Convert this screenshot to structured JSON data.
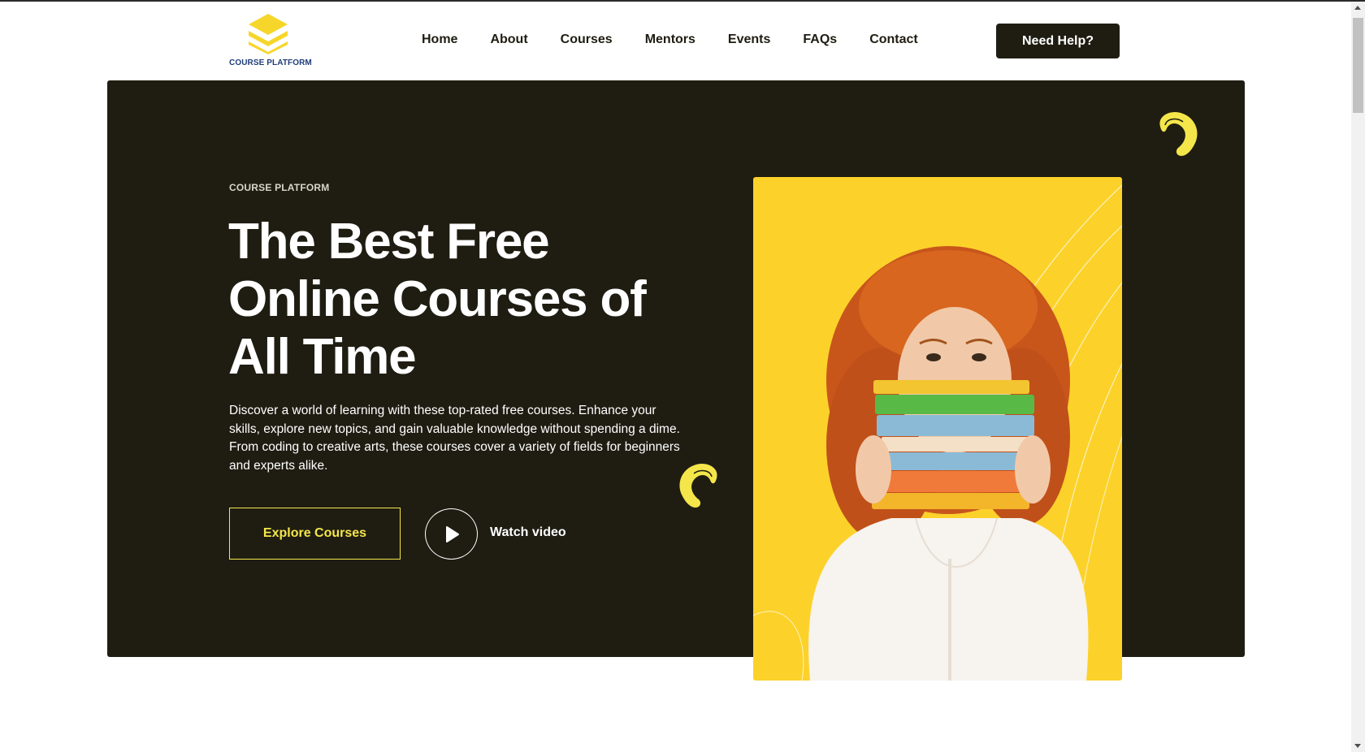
{
  "brand": {
    "name": "COURSE PLATFORM",
    "logo_icon": "stacked-layers-logo-icon"
  },
  "nav": {
    "items": [
      {
        "label": "Home"
      },
      {
        "label": "About"
      },
      {
        "label": "Courses"
      },
      {
        "label": "Mentors"
      },
      {
        "label": "Events"
      },
      {
        "label": "FAQs"
      },
      {
        "label": "Contact"
      }
    ],
    "cta_label": "Need Help?"
  },
  "hero": {
    "eyebrow": "COURSE PLATFORM",
    "headline": "The Best Free Online Courses of All Time",
    "description": "Discover a world of learning with these top-rated free courses. Enhance your skills, explore new topics, and gain valuable knowledge without spending a dime. From coding to creative arts, these courses cover a variety of fields for beginners and experts alike.",
    "primary_button": "Explore Courses",
    "video_label": "Watch video",
    "play_icon": "play-icon",
    "image_icon": "woman-holding-books-photo"
  },
  "colors": {
    "hero_background": "#1f1d12",
    "accent_yellow": "#fcd22a",
    "button_outline": "#f4e64a",
    "logo_yellow": "#f7d62b",
    "logo_text": "#1f3d7a"
  }
}
